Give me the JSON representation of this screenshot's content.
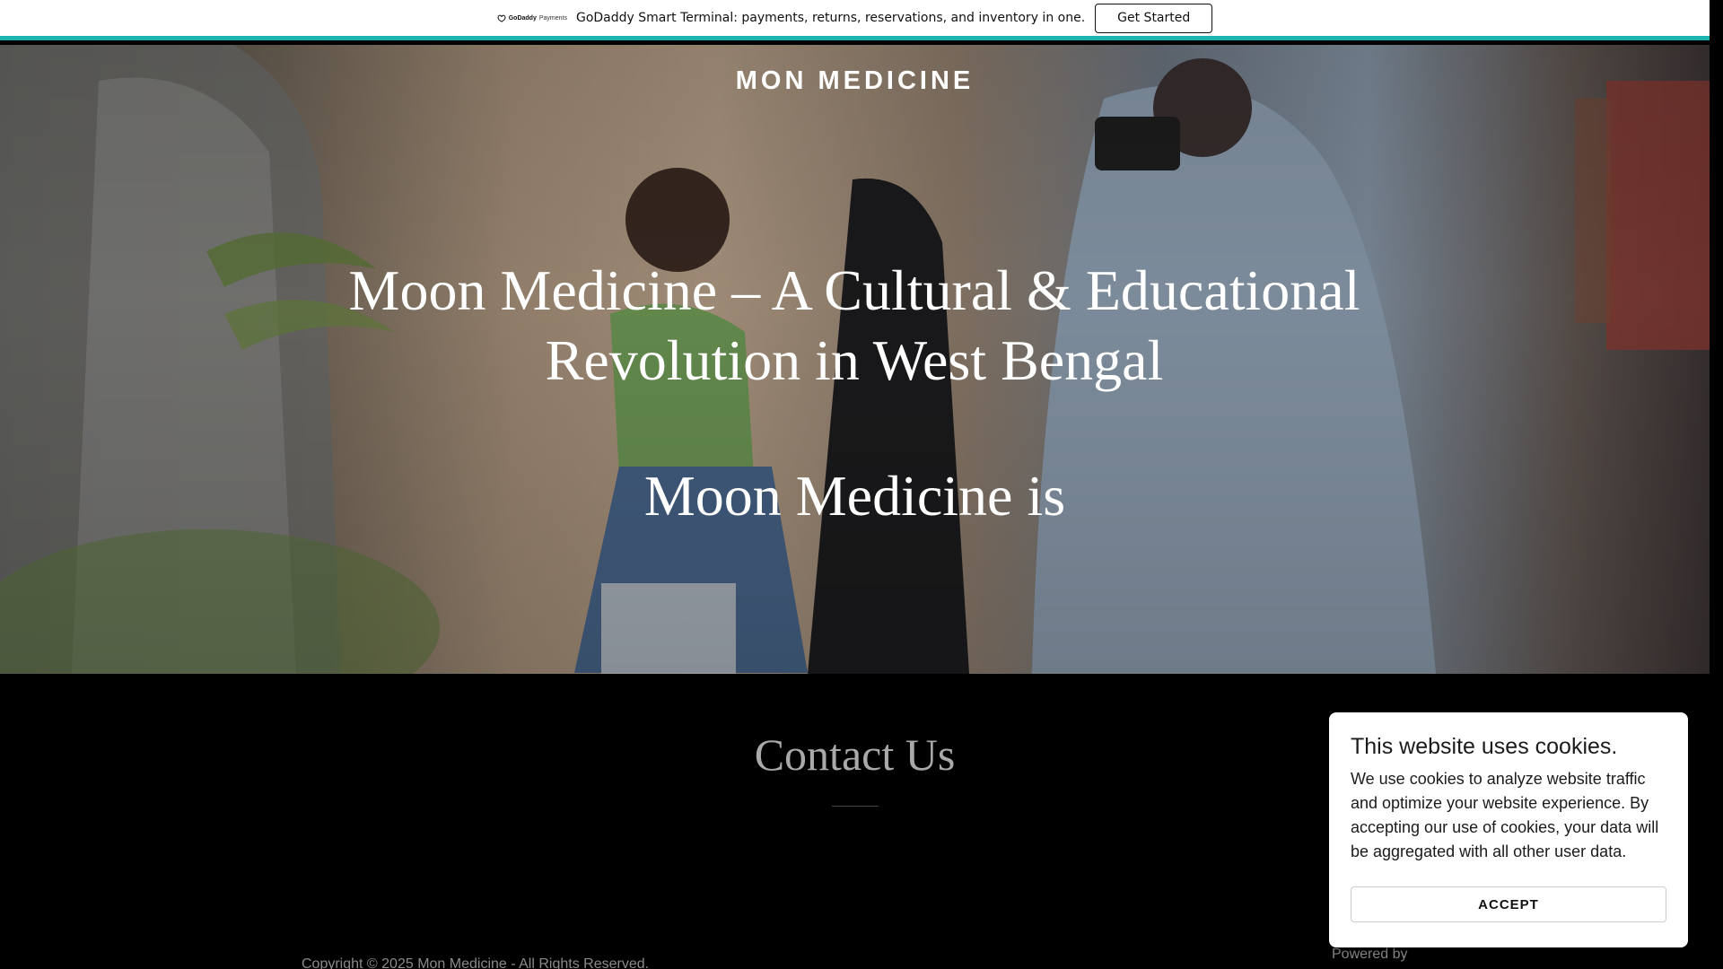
{
  "promo": {
    "logo_brand": "GoDaddy",
    "logo_product": "Payments",
    "logo_icon": "godaddy-icon",
    "text": "GoDaddy Smart Terminal: payments, returns, reservations, and inventory in one.",
    "button_label": "Get Started",
    "accent_color": "#1bb3b0"
  },
  "hero": {
    "site_title": "MON MEDICINE",
    "heading": "Moon Medicine – A Cultural & Educational Revolution in West Bengal",
    "subheading": "Moon Medicine is"
  },
  "contact": {
    "title": "Contact Us"
  },
  "footer": {
    "copyright": "Copyright © 2025 Mon Medicine - All Rights Reserved.",
    "powered_by": "Powered by"
  },
  "cookie_banner": {
    "title": "This website uses cookies.",
    "body": "We use cookies to analyze website traffic and optimize your website experience. By accepting our use of cookies, your data will be aggregated with all other user data.",
    "accept_label": "ACCEPT"
  }
}
